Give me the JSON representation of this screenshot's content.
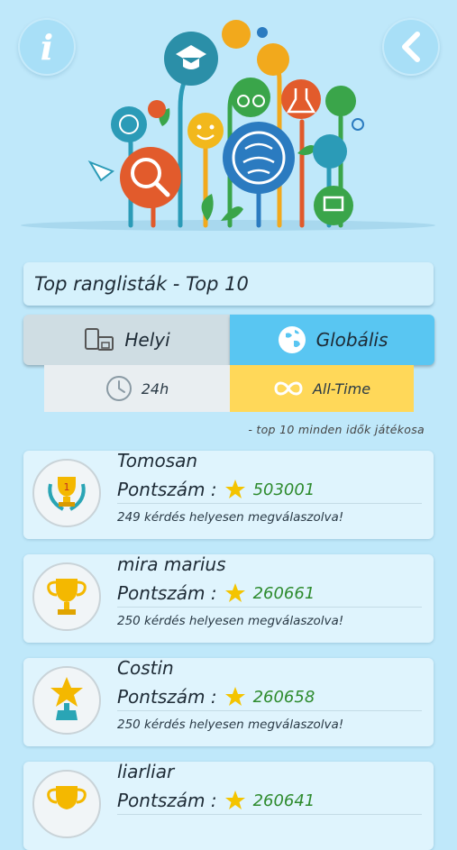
{
  "header": {
    "info_label": "i"
  },
  "leaderboard": {
    "title": "Top ranglisták - Top 10",
    "scope_tabs": {
      "local": "Helyi",
      "global": "Globális",
      "selected": "global"
    },
    "time_tabs": {
      "day": "24h",
      "alltime": "All-Time",
      "selected": "alltime"
    },
    "subtitle": "- top 10 minden idők játékosa",
    "score_label": "Pontszám :",
    "entries": [
      {
        "name": "Tomosan",
        "score": "503001",
        "answered": "249 kérdés helyesen megválaszolva!",
        "medal": "laurel-trophy-icon"
      },
      {
        "name": "mira marius",
        "score": "260661",
        "answered": "250 kérdés helyesen megválaszolva!",
        "medal": "gold-cup-icon"
      },
      {
        "name": "Costin",
        "score": "260658",
        "answered": "250 kérdés helyesen megválaszolva!",
        "medal": "star-trophy-icon"
      },
      {
        "name": "liarliar",
        "score": "260641",
        "answered": "",
        "medal": "gold-cup-icon"
      }
    ]
  },
  "colors": {
    "background": "#bfe8fa",
    "selected_tab": "#59c6f2",
    "selected_time": "#ffd859",
    "score": "#2e8b2e"
  }
}
